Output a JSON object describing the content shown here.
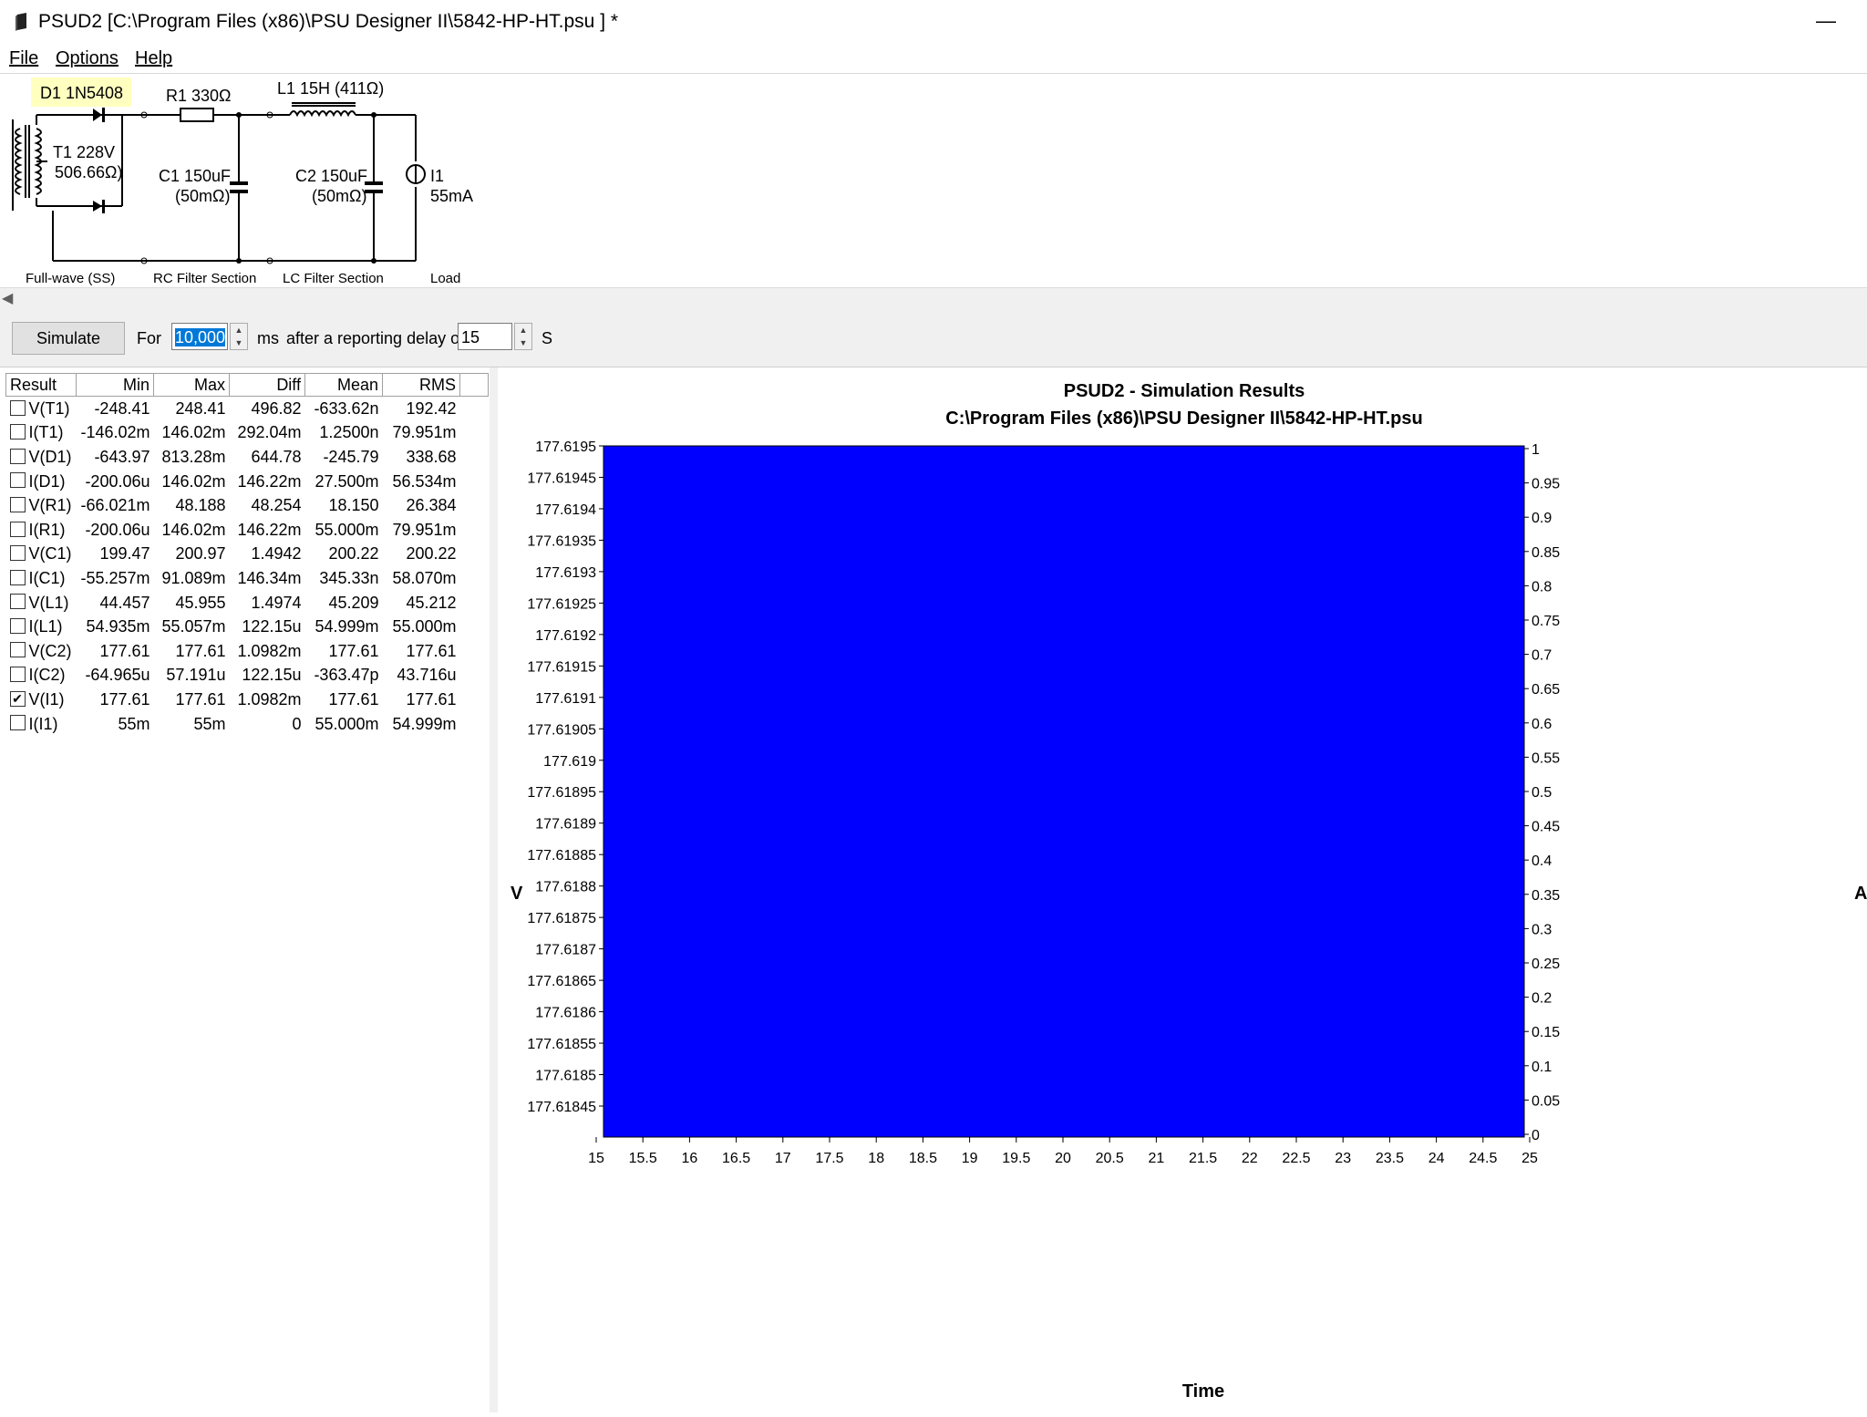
{
  "window": {
    "title": "PSUD2  [C:\\Program Files (x86)\\PSU Designer II\\5842-HP-HT.psu ] *",
    "minimize": "—"
  },
  "menu": [
    {
      "label": "File"
    },
    {
      "label": "Options"
    },
    {
      "label": "Help"
    }
  ],
  "schematic": {
    "d1": "D1 1N5408",
    "r1": "R1 330Ω",
    "l1": "L1 15H (411Ω)",
    "t1_line1": "T1 228V",
    "t1_line2": "506.66Ω)",
    "c1_line1": "C1 150uF",
    "c1_line2": "(50mΩ)",
    "c2_line1": "C2 150uF",
    "c2_line2": "(50mΩ)",
    "i1_line1": "I1",
    "i1_line2": "55mA",
    "sections": [
      "Full-wave (SS)",
      "RC Filter Section",
      "LC Filter Section",
      "Load"
    ]
  },
  "toolbar": {
    "simulate": "Simulate",
    "for_label": "For",
    "duration": "10,000",
    "ms_label": "ms",
    "after_label": "after a reporting delay of",
    "delay": "15",
    "s_label": "S"
  },
  "results": {
    "headers": [
      "Result",
      "Min",
      "Max",
      "Diff",
      "Mean",
      "RMS"
    ],
    "rows": [
      {
        "name": "V(T1)",
        "checked": false,
        "min": "-248.41",
        "max": "248.41",
        "diff": "496.82",
        "mean": "-633.62n",
        "rms": "192.42"
      },
      {
        "name": "I(T1)",
        "checked": false,
        "min": "-146.02m",
        "max": "146.02m",
        "diff": "292.04m",
        "mean": "1.2500n",
        "rms": "79.951m"
      },
      {
        "name": "V(D1)",
        "checked": false,
        "min": "-643.97",
        "max": "813.28m",
        "diff": "644.78",
        "mean": "-245.79",
        "rms": "338.68"
      },
      {
        "name": "I(D1)",
        "checked": false,
        "min": "-200.06u",
        "max": "146.02m",
        "diff": "146.22m",
        "mean": "27.500m",
        "rms": "56.534m"
      },
      {
        "name": "V(R1)",
        "checked": false,
        "min": "-66.021m",
        "max": "48.188",
        "diff": "48.254",
        "mean": "18.150",
        "rms": "26.384"
      },
      {
        "name": "I(R1)",
        "checked": false,
        "min": "-200.06u",
        "max": "146.02m",
        "diff": "146.22m",
        "mean": "55.000m",
        "rms": "79.951m"
      },
      {
        "name": "V(C1)",
        "checked": false,
        "min": "199.47",
        "max": "200.97",
        "diff": "1.4942",
        "mean": "200.22",
        "rms": "200.22"
      },
      {
        "name": "I(C1)",
        "checked": false,
        "min": "-55.257m",
        "max": "91.089m",
        "diff": "146.34m",
        "mean": "345.33n",
        "rms": "58.070m"
      },
      {
        "name": "V(L1)",
        "checked": false,
        "min": "44.457",
        "max": "45.955",
        "diff": "1.4974",
        "mean": "45.209",
        "rms": "45.212"
      },
      {
        "name": "I(L1)",
        "checked": false,
        "min": "54.935m",
        "max": "55.057m",
        "diff": "122.15u",
        "mean": "54.999m",
        "rms": "55.000m"
      },
      {
        "name": "V(C2)",
        "checked": false,
        "min": "177.61",
        "max": "177.61",
        "diff": "1.0982m",
        "mean": "177.61",
        "rms": "177.61"
      },
      {
        "name": "I(C2)",
        "checked": false,
        "min": "-64.965u",
        "max": "57.191u",
        "diff": "122.15u",
        "mean": "-363.47p",
        "rms": "43.716u"
      },
      {
        "name": "V(I1)",
        "checked": true,
        "min": "177.61",
        "max": "177.61",
        "diff": "1.0982m",
        "mean": "177.61",
        "rms": "177.61"
      },
      {
        "name": "I(I1)",
        "checked": false,
        "min": "55m",
        "max": "55m",
        "diff": "0",
        "mean": "55.000m",
        "rms": "54.999m"
      }
    ]
  },
  "chart_data": {
    "type": "area",
    "title": "PSUD2 - Simulation Results",
    "subtitle": "C:\\Program Files (x86)\\PSU Designer II\\5842-HP-HT.psu",
    "xlabel": "Time",
    "ylabel": "V",
    "y2label": "A",
    "xlim": [
      15,
      25
    ],
    "ylim": [
      177.6184,
      177.6195
    ],
    "y2lim": [
      0,
      1
    ],
    "xticks": [
      "15",
      "15.5",
      "16",
      "16.5",
      "17",
      "17.5",
      "18",
      "18.5",
      "19",
      "19.5",
      "20",
      "20.5",
      "21",
      "21.5",
      "22",
      "22.5",
      "23",
      "23.5",
      "24",
      "24.5",
      "25"
    ],
    "yticks": [
      "177.6195",
      "177.61945",
      "177.6194",
      "177.61935",
      "177.6193",
      "177.61925",
      "177.6192",
      "177.61915",
      "177.6191",
      "177.61905",
      "177.619",
      "177.61895",
      "177.6189",
      "177.61885",
      "177.6188",
      "177.61875",
      "177.6187",
      "177.61865",
      "177.6186",
      "177.61855",
      "177.6185",
      "177.61845"
    ],
    "y2ticks": [
      "1",
      "0.95",
      "0.9",
      "0.85",
      "0.8",
      "0.75",
      "0.7",
      "0.65",
      "0.6",
      "0.55",
      "0.5",
      "0.45",
      "0.4",
      "0.35",
      "0.3",
      "0.25",
      "0.2",
      "0.15",
      "0.1",
      "0.05",
      "0"
    ],
    "series": [
      {
        "name": "V(I1)",
        "color": "#0000ff",
        "fill": "solid"
      }
    ],
    "grid": false
  }
}
